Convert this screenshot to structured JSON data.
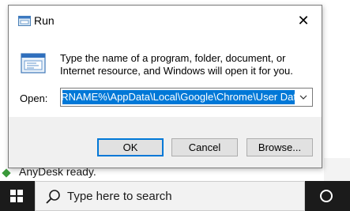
{
  "desktop": {
    "anydesk_text": "AnyDesk ready."
  },
  "run_dialog": {
    "title": "Run",
    "close_glyph": "✕",
    "description": "Type the name of a program, folder, document, or Internet resource, and Windows will open it for you.",
    "open_label": "Open:",
    "open_value": "%USERNAME%\\AppData\\Local\\Google\\Chrome\\User Data",
    "dropdown_glyph": "⌵",
    "buttons": {
      "ok": "OK",
      "cancel": "Cancel",
      "browse": "Browse..."
    }
  },
  "taskbar": {
    "search_placeholder": "Type here to search",
    "icons": [
      "windows-start-icon",
      "search-icon",
      "cortana-icon"
    ]
  },
  "colors": {
    "selection": "#0078d7",
    "taskbar": "#1b1b1b"
  }
}
